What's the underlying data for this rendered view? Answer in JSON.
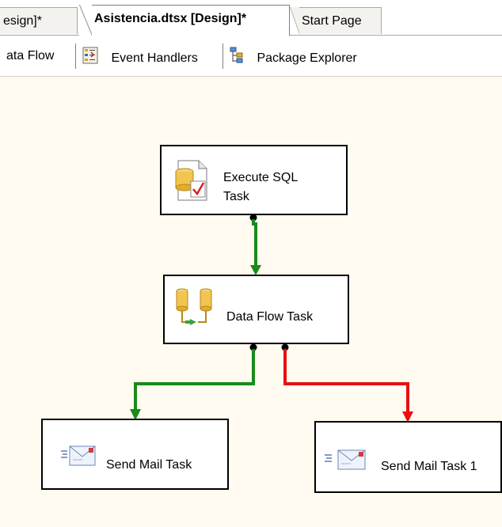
{
  "document_tabs": [
    {
      "label": "esign]*",
      "state": "inactive"
    },
    {
      "label": "Asistencia.dtsx [Design]*",
      "state": "active"
    },
    {
      "label": "Start Page",
      "state": "inactive"
    }
  ],
  "designer_tabs": {
    "data_flow": "ata Flow",
    "event_handlers": "Event Handlers",
    "package_explorer": "Package Explorer"
  },
  "tasks": {
    "execute_sql": "Execute SQL Task",
    "data_flow": "Data Flow Task",
    "send_mail": "Send Mail Task",
    "send_mail_1": "Send Mail Task 1"
  },
  "precedence_constraints": [
    {
      "from": "Execute SQL Task",
      "to": "Data Flow Task",
      "type": "success",
      "color": "#1a8a1a"
    },
    {
      "from": "Data Flow Task",
      "to": "Send Mail Task",
      "type": "success",
      "color": "#1a8a1a"
    },
    {
      "from": "Data Flow Task",
      "to": "Send Mail Task 1",
      "type": "failure",
      "color": "#e81010"
    }
  ],
  "colors": {
    "canvas_background": "#fffbf0",
    "success": "#1a8a1a",
    "failure": "#e81010"
  },
  "icons": {
    "event_handlers": "event-handlers-icon",
    "package_explorer": "package-explorer-icon",
    "execute_sql": "execute-sql-task-icon",
    "data_flow": "data-flow-task-icon",
    "send_mail": "send-mail-task-icon"
  }
}
